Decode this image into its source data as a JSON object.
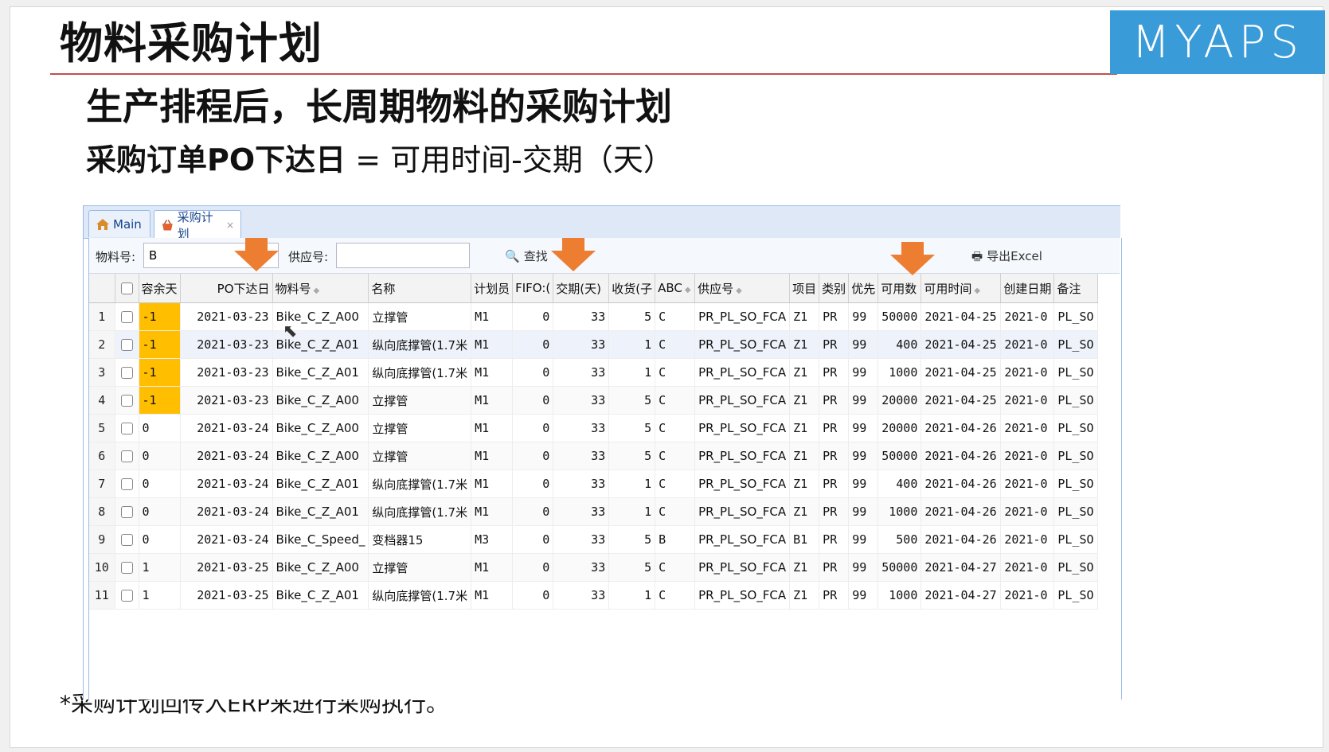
{
  "slide": {
    "title": "物料采购计划",
    "subtitle1": "生产排程后，长周期物料的采购计划",
    "formula_bold": "采购订单PO下达日",
    "formula_rest": " = 可用时间-交期（天）",
    "footnote": "*采购计划回传入ERP来进行采购执行。",
    "logo_text": "MYAPS"
  },
  "tabs": [
    {
      "label": "Main",
      "icon": "home-icon"
    },
    {
      "label": "采购计划",
      "icon": "basket-icon",
      "close": "×"
    }
  ],
  "toolbar": {
    "material_label": "物料号:",
    "material_value": "B",
    "supplier_label": "供应号:",
    "supplier_value": "",
    "search_label": "查找",
    "export_label": "导出Excel"
  },
  "columns": [
    "容余天",
    "PO下达日",
    "物料号",
    "名称",
    "计划员",
    "FIFO:(",
    "交期(天)",
    "收货(子",
    "ABC",
    "供应号",
    "项目",
    "类别",
    "优先",
    "可用数",
    "可用时间",
    "创建日期",
    "备注"
  ],
  "rows": [
    [
      "1",
      "-1",
      "2021-03-23",
      "Bike_C_Z_A00",
      "立撑管",
      "M1",
      "0",
      "33",
      "5",
      "C",
      "PR_PL_SO_FCA",
      "Z1",
      "PR",
      "99",
      "50000",
      "2021-04-25",
      "2021-0",
      "PL_SO"
    ],
    [
      "2",
      "-1",
      "2021-03-23",
      "Bike_C_Z_A01",
      "纵向底撑管(1.7米",
      "M1",
      "0",
      "33",
      "1",
      "C",
      "PR_PL_SO_FCA",
      "Z1",
      "PR",
      "99",
      "400",
      "2021-04-25",
      "2021-0",
      "PL_SO"
    ],
    [
      "3",
      "-1",
      "2021-03-23",
      "Bike_C_Z_A01",
      "纵向底撑管(1.7米",
      "M1",
      "0",
      "33",
      "1",
      "C",
      "PR_PL_SO_FCA",
      "Z1",
      "PR",
      "99",
      "1000",
      "2021-04-25",
      "2021-0",
      "PL_SO"
    ],
    [
      "4",
      "-1",
      "2021-03-23",
      "Bike_C_Z_A00",
      "立撑管",
      "M1",
      "0",
      "33",
      "5",
      "C",
      "PR_PL_SO_FCA",
      "Z1",
      "PR",
      "99",
      "20000",
      "2021-04-25",
      "2021-0",
      "PL_SO"
    ],
    [
      "5",
      "0",
      "2021-03-24",
      "Bike_C_Z_A00",
      "立撑管",
      "M1",
      "0",
      "33",
      "5",
      "C",
      "PR_PL_SO_FCA",
      "Z1",
      "PR",
      "99",
      "20000",
      "2021-04-26",
      "2021-0",
      "PL_SO"
    ],
    [
      "6",
      "0",
      "2021-03-24",
      "Bike_C_Z_A00",
      "立撑管",
      "M1",
      "0",
      "33",
      "5",
      "C",
      "PR_PL_SO_FCA",
      "Z1",
      "PR",
      "99",
      "50000",
      "2021-04-26",
      "2021-0",
      "PL_SO"
    ],
    [
      "7",
      "0",
      "2021-03-24",
      "Bike_C_Z_A01",
      "纵向底撑管(1.7米",
      "M1",
      "0",
      "33",
      "1",
      "C",
      "PR_PL_SO_FCA",
      "Z1",
      "PR",
      "99",
      "400",
      "2021-04-26",
      "2021-0",
      "PL_SO"
    ],
    [
      "8",
      "0",
      "2021-03-24",
      "Bike_C_Z_A01",
      "纵向底撑管(1.7米",
      "M1",
      "0",
      "33",
      "1",
      "C",
      "PR_PL_SO_FCA",
      "Z1",
      "PR",
      "99",
      "1000",
      "2021-04-26",
      "2021-0",
      "PL_SO"
    ],
    [
      "9",
      "0",
      "2021-03-24",
      "Bike_C_Speed_",
      "变档器15",
      "M3",
      "0",
      "33",
      "5",
      "B",
      "PR_PL_SO_FCA",
      "B1",
      "PR",
      "99",
      "500",
      "2021-04-26",
      "2021-0",
      "PL_SO"
    ],
    [
      "10",
      "1",
      "2021-03-25",
      "Bike_C_Z_A00",
      "立撑管",
      "M1",
      "0",
      "33",
      "5",
      "C",
      "PR_PL_SO_FCA",
      "Z1",
      "PR",
      "99",
      "50000",
      "2021-04-27",
      "2021-0",
      "PL_SO"
    ],
    [
      "11",
      "1",
      "2021-03-25",
      "Bike_C_Z_A01",
      "纵向底撑管(1.7米",
      "M1",
      "0",
      "33",
      "1",
      "C",
      "PR_PL_SO_FCA",
      "Z1",
      "PR",
      "99",
      "1000",
      "2021-04-27",
      "2021-0",
      "PL_SO"
    ]
  ],
  "colors": {
    "accent_red": "#c0504d",
    "logo_blue": "#3a9bd9",
    "highlight": "#ffbf00",
    "arrow": "#ed7d31"
  }
}
